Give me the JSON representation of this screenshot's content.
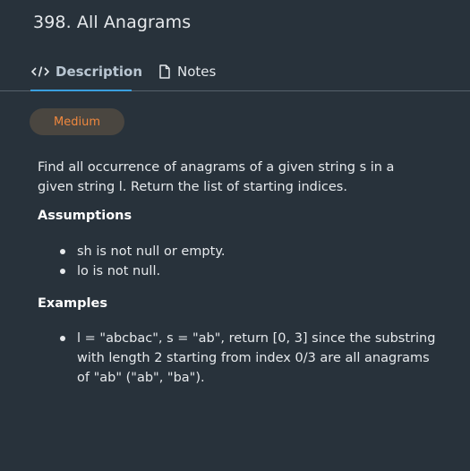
{
  "problem": {
    "title": "398. All Anagrams",
    "difficulty": "Medium",
    "description": "Find all occurrence of anagrams of a given string s in a given string l. Return the list of starting indices."
  },
  "tabs": [
    {
      "label": "Description",
      "icon": "code-icon",
      "active": true
    },
    {
      "label": "Notes",
      "icon": "document-icon",
      "active": false
    }
  ],
  "assumptions": {
    "heading": "Assumptions",
    "items": [
      "sh is not null or empty.",
      "lo is not null."
    ]
  },
  "examples": {
    "heading": "Examples",
    "items": [
      "l = \"abcbac\", s = \"ab\", return [0, 3] since the substring with length 2 starting from index 0/3 are all anagrams of \"ab\" (\"ab\", \"ba\")."
    ]
  },
  "colors": {
    "background": "#28323b",
    "accent": "#3aa0e0",
    "difficulty_text": "#f0883e",
    "difficulty_bg": "#4a4640"
  }
}
